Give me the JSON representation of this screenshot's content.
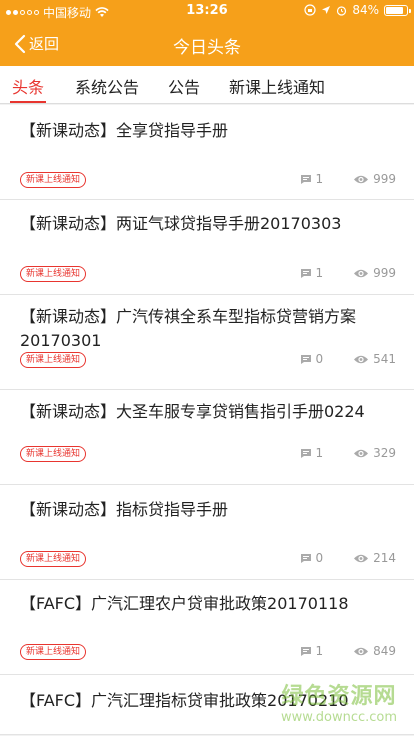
{
  "status_bar": {
    "carrier": "中国移动",
    "time": "13:26",
    "battery": "84%",
    "battery_level": 0.84
  },
  "nav": {
    "back_label": "返回",
    "title": "今日头条"
  },
  "tabs": [
    {
      "label": "头条",
      "active": true
    },
    {
      "label": "系统公告",
      "active": false
    },
    {
      "label": "公告",
      "active": false
    },
    {
      "label": "新课上线通知",
      "active": false
    }
  ],
  "items": [
    {
      "title": "【新课动态】全享贷指导手册",
      "badge": "新课上线通知",
      "comments": "1",
      "views": "999"
    },
    {
      "title": "【新课动态】两证气球贷指导手册20170303",
      "badge": "新课上线通知",
      "comments": "1",
      "views": "999"
    },
    {
      "title": "【新课动态】广汽传祺全系车型指标贷营销方案20170301",
      "badge": "新课上线通知",
      "comments": "0",
      "views": "541"
    },
    {
      "title": "【新课动态】大圣车服专享贷销售指引手册0224",
      "badge": "新课上线通知",
      "comments": "1",
      "views": "329"
    },
    {
      "title": "【新课动态】指标贷指导手册",
      "badge": "新课上线通知",
      "comments": "0",
      "views": "214"
    },
    {
      "title": "【FAFC】广汽汇理农户贷审批政策20170118",
      "badge": "新课上线通知",
      "comments": "1",
      "views": "849"
    },
    {
      "title": "【FAFC】广汽汇理指标贷审批政策20170210",
      "badge": "",
      "comments": "",
      "views": ""
    }
  ],
  "watermark": {
    "main": "绿色资源网",
    "sub": "www.downcc.com"
  },
  "colors": {
    "brand": "#f6a01a",
    "accent": "#e8352f"
  }
}
